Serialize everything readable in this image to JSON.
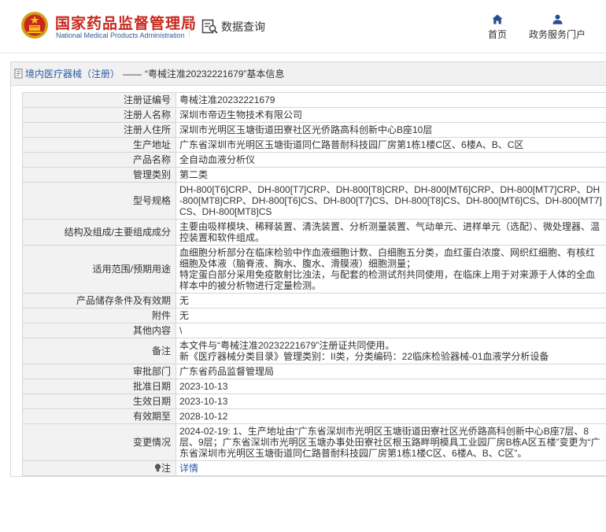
{
  "header": {
    "org_name_cn": "国家药品监督管理局",
    "org_name_en": "National Medical Products Administration",
    "data_query": "数据查询",
    "nav": {
      "home": "首页",
      "gov_portal": "政务服务门户"
    }
  },
  "breadcrumb": {
    "category": "境内医疗器械（注册）",
    "separator": "——",
    "item": "“粤械注准20232221679”基本信息"
  },
  "details": [
    {
      "label": "注册证编号",
      "value": "粤械注准20232221679"
    },
    {
      "label": "注册人名称",
      "value": "深圳市帝迈生物技术有限公司"
    },
    {
      "label": "注册人住所",
      "value": "深圳市光明区玉塘街道田寮社区光侨路高科创新中心B座10层"
    },
    {
      "label": "生产地址",
      "value": "广东省深圳市光明区玉塘街道同仁路普耐科技园厂房第1栋1楼C区、6楼A、B、C区"
    },
    {
      "label": "产品名称",
      "value": "全自动血液分析仪"
    },
    {
      "label": "管理类别",
      "value": "第二类"
    },
    {
      "label": "型号规格",
      "value": "DH-800[T6]CRP、DH-800[T7]CRP、DH-800[T8]CRP、DH-800[MT6]CRP、DH-800[MT7]CRP、DH-800[MT8]CRP、DH-800[T6]CS、DH-800[T7]CS、DH-800[T8]CS、DH-800[MT6]CS、DH-800[MT7]CS、DH-800[MT8]CS"
    },
    {
      "label": "结构及组成/主要组成成分",
      "value": "主要由吸样模块、稀释装置、清洗装置、分析测量装置、气动单元、进样单元（选配）、微处理器、温控装置和软件组成。"
    },
    {
      "label": "适用范围/预期用途",
      "value": "血细胞分析部分在临床检验中作血液细胞计数、白细胞五分类，血红蛋白浓度、网织红细胞、有核红细胞及体液（脑脊液、胸水、腹水、滑膜液）细胞测量；\n特定蛋白部分采用免疫散射比浊法，与配套的检测试剂共同使用，在临床上用于对来源于人体的全血样本中的被分析物进行定量检测。"
    },
    {
      "label": "产品储存条件及有效期",
      "value": "无"
    },
    {
      "label": "附件",
      "value": "无"
    },
    {
      "label": "其他内容",
      "value": "\\"
    },
    {
      "label": "备注",
      "value": "本文件与“粤械注准20232221679”注册证共同使用。\n新《医疗器械分类目录》管理类别：II类，分类编码：22临床检验器械-01血液学分析设备"
    },
    {
      "label": "审批部门",
      "value": "广东省药品监督管理局"
    },
    {
      "label": "批准日期",
      "value": "2023-10-13"
    },
    {
      "label": "生效日期",
      "value": "2023-10-13"
    },
    {
      "label": "有效期至",
      "value": "2028-10-12"
    },
    {
      "label": "变更情况",
      "value": "2024-02-19: 1、生产地址由“广东省深圳市光明区玉塘街道田寮社区光侨路高科创新中心B座7层、8层、9层；广东省深圳市光明区玉塘办事处田寮社区根玉路畔明模具工业园厂房B栋A区五楼”变更为“广东省深圳市光明区玉塘街道同仁路普耐科技园厂房第1栋1楼C区、6楼A、B、C区”。"
    }
  ],
  "note_row": {
    "label": "注",
    "link": "详情"
  }
}
